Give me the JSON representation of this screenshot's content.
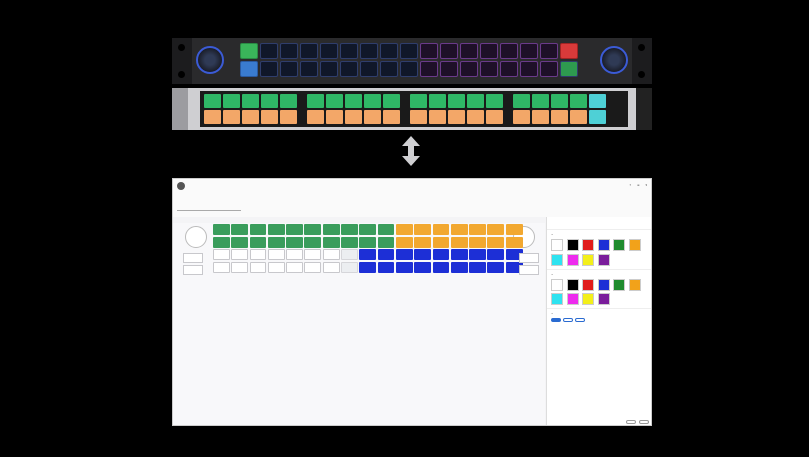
{
  "rack1": {
    "rows": [
      [
        "green",
        "",
        "",
        "",
        "",
        "",
        "",
        "",
        "",
        "purple",
        "purple",
        "purple",
        "purple",
        "purple",
        "purple",
        "purple",
        "red"
      ],
      [
        "blue",
        "",
        "",
        "",
        "",
        "",
        "",
        "",
        "",
        "purple",
        "purple",
        "purple",
        "purple",
        "purple",
        "purple",
        "purple",
        "gr2"
      ]
    ]
  },
  "rack2": {
    "row1": [
      "g",
      "g",
      "g",
      "g",
      "g",
      "|",
      "g",
      "g",
      "g",
      "g",
      "g",
      "|",
      "g",
      "g",
      "g",
      "g",
      "g",
      "|",
      "g",
      "g",
      "g",
      "g",
      "c"
    ],
    "row2": [
      "o",
      "o",
      "o",
      "o",
      "o",
      "|",
      "o",
      "o",
      "o",
      "o",
      "o",
      "|",
      "o",
      "o",
      "o",
      "o",
      "o",
      "|",
      "o",
      "o",
      "o",
      "o",
      "c"
    ]
  },
  "colors": {
    "app_accent": "#2a6bd1",
    "green": "#3a9d5c",
    "orange": "#f2a830",
    "blue": "#1d2fd6"
  },
  "canvas": {
    "rows": [
      [
        "green",
        "green",
        "green",
        "green",
        "green",
        "green",
        "green",
        "green",
        "green",
        "green",
        "orange",
        "orange",
        "orange",
        "orange",
        "orange",
        "orange",
        "orange"
      ],
      [
        "green",
        "green",
        "green",
        "green",
        "green",
        "green",
        "green",
        "green",
        "green",
        "green",
        "orange",
        "orange",
        "orange",
        "orange",
        "orange",
        "orange",
        "orange"
      ],
      [
        "white",
        "white",
        "white",
        "white",
        "white",
        "white",
        "white",
        "empty",
        "blue",
        "blue",
        "blue",
        "blue",
        "blue",
        "blue",
        "blue",
        "blue",
        "blue"
      ],
      [
        "white",
        "white",
        "white",
        "white",
        "white",
        "white",
        "white",
        "empty",
        "blue",
        "blue",
        "blue",
        "blue",
        "blue",
        "blue",
        "blue",
        "blue",
        "blue"
      ]
    ]
  },
  "swatches1": [
    "#ffffff",
    "#000000",
    "#e01b1b",
    "#1d2fd6",
    "#1f8c2e",
    "#f2a21a",
    "#2fe3f0",
    "#ee2bee",
    "#f3ef1a",
    "#7a1d9b"
  ],
  "swatches2": [
    "#ffffff",
    "#000000",
    "#e01b1b",
    "#1d2fd6",
    "#1f8c2e",
    "#f2a21a",
    "#2fe3f0",
    "#ee2bee",
    "#f3ef1a",
    "#7a1d9b"
  ]
}
